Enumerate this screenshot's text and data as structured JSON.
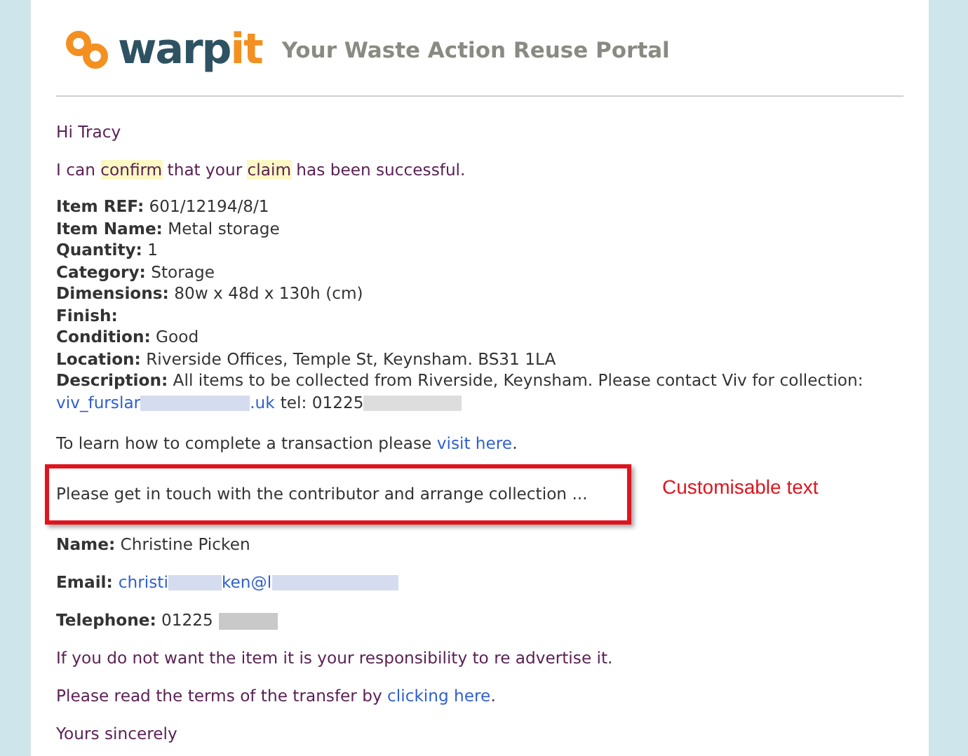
{
  "header": {
    "logo_left": "warp",
    "logo_right": "it",
    "tagline": "Your Waste Action Reuse Portal"
  },
  "greeting": "Hi Tracy",
  "confirmation": [
    {
      "text": "I can ",
      "highlight": false
    },
    {
      "text": "confirm",
      "highlight": true
    },
    {
      "text": " that your ",
      "highlight": false
    },
    {
      "text": "claim",
      "highlight": true
    },
    {
      "text": " has been successful.",
      "highlight": false
    }
  ],
  "details": [
    {
      "label": "Item REF:",
      "value": "601/12194/8/1"
    },
    {
      "label": "Item Name:",
      "value": "Metal storage"
    },
    {
      "label": "Quantity:",
      "value": "1"
    },
    {
      "label": "Category:",
      "value": "Storage"
    },
    {
      "label": "Dimensions:",
      "value": "80w x 48d x 130h (cm)"
    },
    {
      "label": "Finish:"
    },
    {
      "label": "Condition:",
      "value": "Good"
    },
    {
      "label": "Location:",
      "value": "Riverside Offices, Temple St, Keynsham. BS31 1LA"
    },
    {
      "label": "Description:",
      "value": "All items to be collected from Riverside, Keynsham. Please contact Viv for collection:"
    }
  ],
  "contact_line": {
    "email_start": "viv_furslar",
    "email_end": ".uk",
    "tel": "tel: 01225"
  },
  "transaction": {
    "text": "To learn how to complete a transaction please ",
    "link": "visit here",
    "end": "."
  },
  "custom_text": "Please get in touch with the contributor and arrange collection ...",
  "annotation": "Customisable text",
  "contributor": {
    "name_label": "Name:",
    "name": "Christine Picken",
    "email_label": "Email:",
    "email_start": "christi",
    "email_mid": "ken@l",
    "phone_label": "Telephone:",
    "phone": "01225"
  },
  "responsibility": "If you do not want the item it is your responsibility to re advertise it.",
  "terms": {
    "text": "Please read the terms of the transfer by ",
    "link": "clicking here",
    "end": "."
  },
  "closing": "Yours sincerely"
}
